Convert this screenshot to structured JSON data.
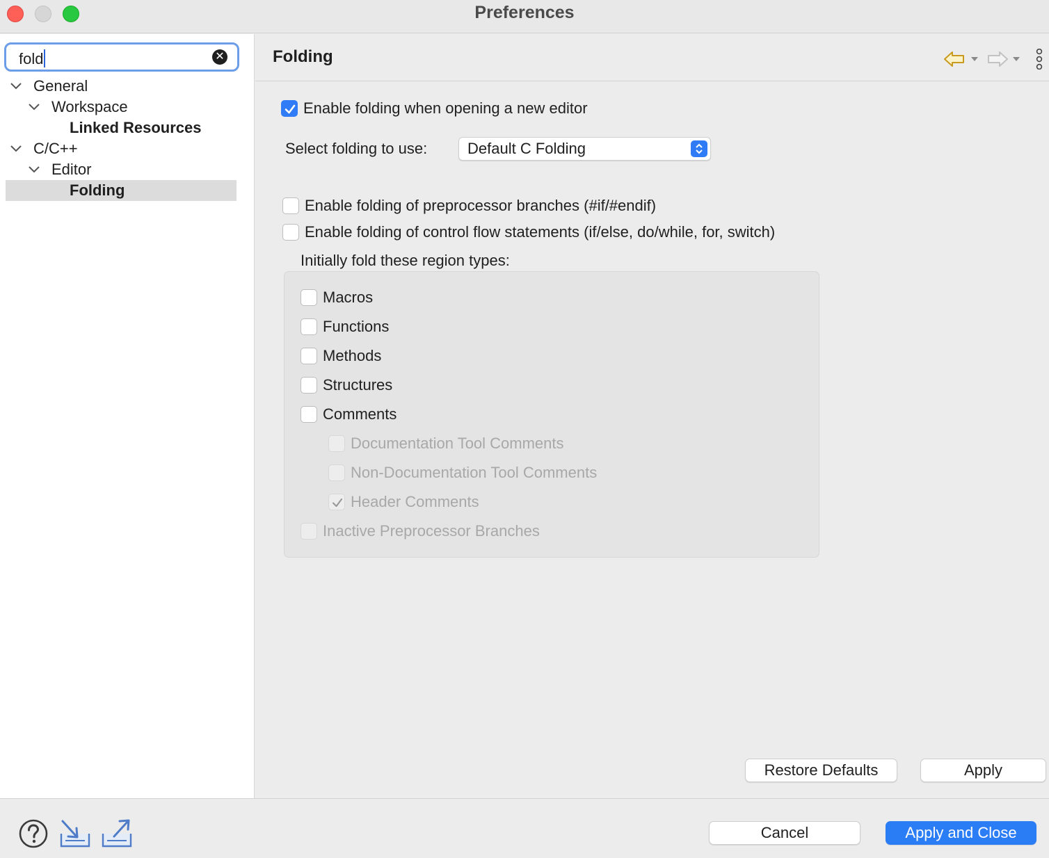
{
  "window": {
    "title": "Preferences"
  },
  "search": {
    "value": "fold"
  },
  "tree": [
    {
      "label": "General"
    },
    {
      "label": "Workspace"
    },
    {
      "label": "Linked Resources"
    },
    {
      "label": "C/C++"
    },
    {
      "label": "Editor"
    },
    {
      "label": "Folding",
      "selected": true
    }
  ],
  "page": {
    "title": "Folding",
    "enable_folding_label": "Enable folding when opening a new editor",
    "enable_folding_checked": true,
    "select_label": "Select folding to use:",
    "select_value": "Default C Folding",
    "preprocessor_label": "Enable folding of preprocessor branches (#if/#endif)",
    "preprocessor_checked": false,
    "control_flow_label": "Enable folding of control flow statements (if/else, do/while, for, switch)",
    "control_flow_checked": false,
    "group_label": "Initially fold these region types:",
    "region_types": [
      {
        "label": "Macros",
        "checked": false,
        "enabled": true
      },
      {
        "label": "Functions",
        "checked": false,
        "enabled": true
      },
      {
        "label": "Methods",
        "checked": false,
        "enabled": true
      },
      {
        "label": "Structures",
        "checked": false,
        "enabled": true
      },
      {
        "label": "Comments",
        "checked": false,
        "enabled": true
      },
      {
        "label": "Documentation Tool Comments",
        "checked": false,
        "enabled": false
      },
      {
        "label": "Non-Documentation Tool Comments",
        "checked": false,
        "enabled": false
      },
      {
        "label": "Header Comments",
        "checked": true,
        "enabled": false
      },
      {
        "label": "Inactive Preprocessor Branches",
        "checked": false,
        "enabled": false
      }
    ],
    "restore_defaults_label": "Restore Defaults",
    "apply_label": "Apply"
  },
  "footer": {
    "cancel_label": "Cancel",
    "apply_close_label": "Apply and Close"
  },
  "icons": {
    "back": "back-arrow-icon",
    "forward": "forward-arrow-icon",
    "menu": "view-menu-icon",
    "help": "help-icon",
    "import": "import-icon",
    "export": "export-icon"
  },
  "colors": {
    "accent": "#2b7df6",
    "search_focus": "#6c9de8",
    "close": "#fe5f57",
    "minimize": "#d6d6d6",
    "maximize": "#28c840",
    "back_arrow": "#c89a1e"
  }
}
